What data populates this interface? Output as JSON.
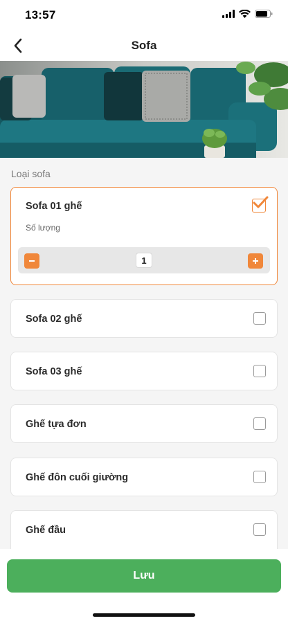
{
  "status": {
    "time": "13:57"
  },
  "header": {
    "title": "Sofa"
  },
  "section": {
    "label": "Loại sofa"
  },
  "options": [
    {
      "label": "Sofa 01 ghế",
      "checked": true,
      "quantity_label": "Số lượng",
      "quantity": "1"
    },
    {
      "label": "Sofa 02 ghế",
      "checked": false
    },
    {
      "label": "Sofa 03 ghế",
      "checked": false
    },
    {
      "label": "Ghế tựa đơn",
      "checked": false
    },
    {
      "label": "Ghế đôn cuối giường",
      "checked": false
    },
    {
      "label": "Ghế đầu",
      "checked": false
    }
  ],
  "footer": {
    "save_label": "Lưu"
  },
  "colors": {
    "accent": "#f0873a",
    "primary_button": "#4caf5c"
  }
}
